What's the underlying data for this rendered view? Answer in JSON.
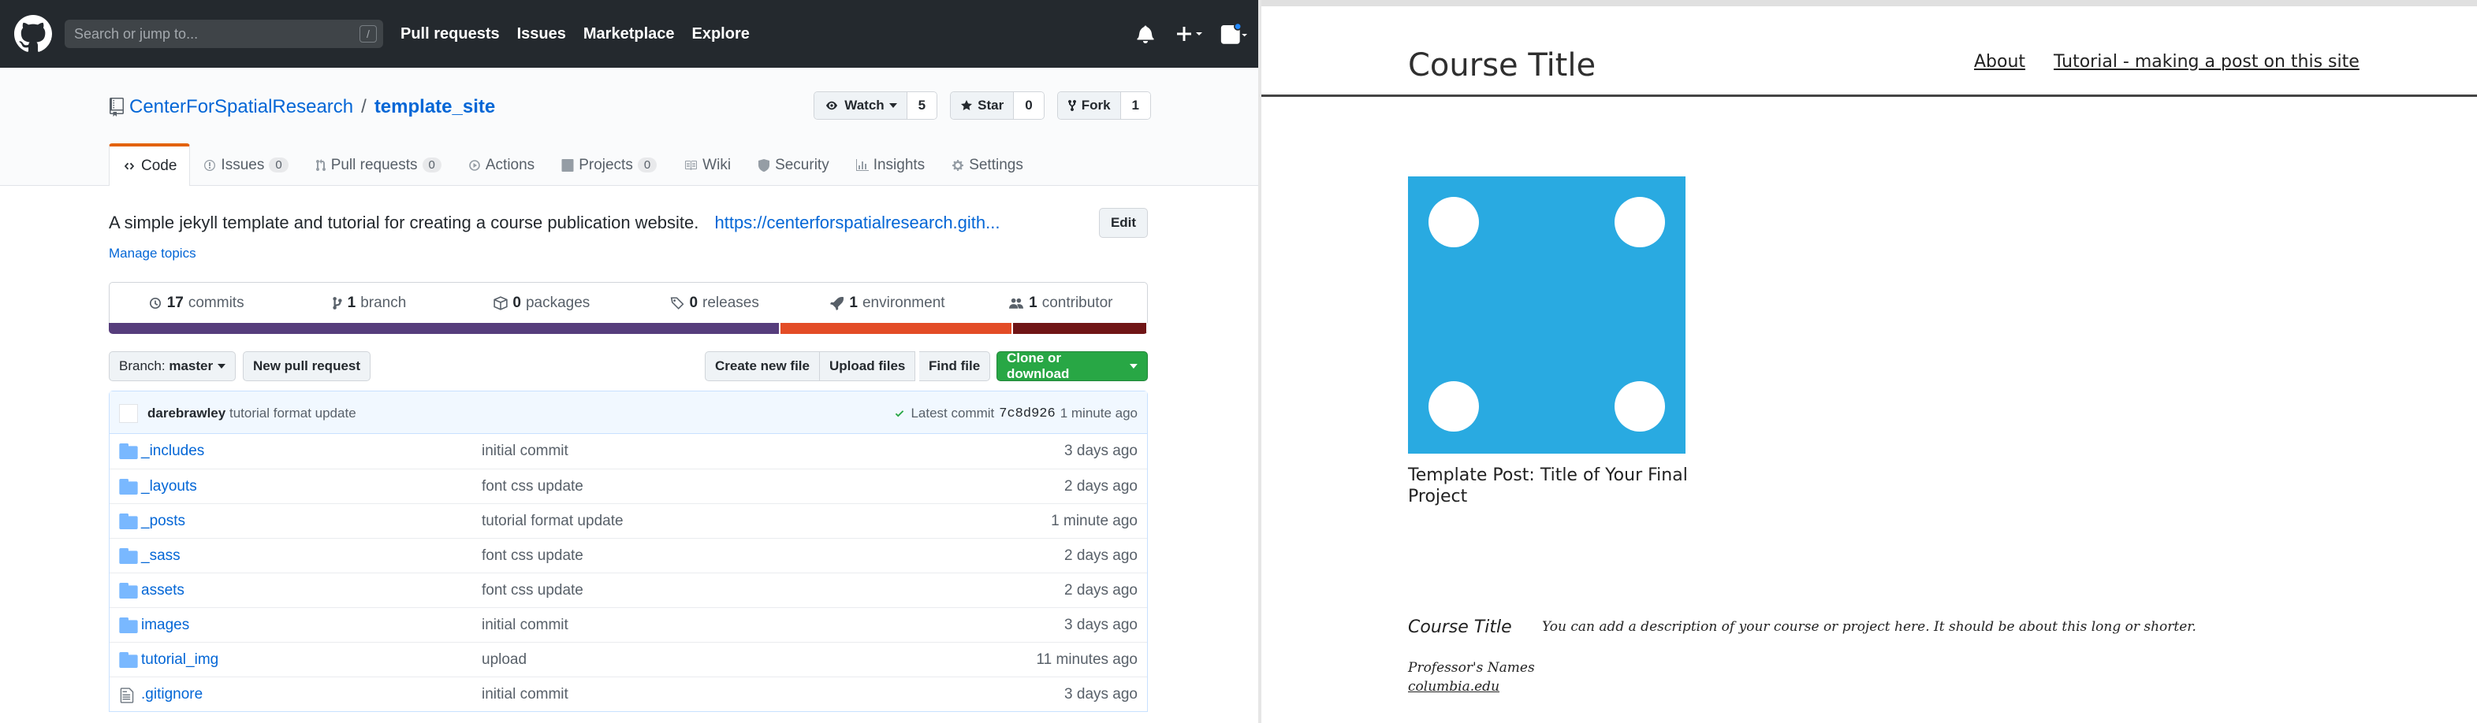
{
  "github": {
    "header": {
      "search_placeholder": "Search or jump to...",
      "search_shortcut": "/",
      "nav": [
        "Pull requests",
        "Issues",
        "Marketplace",
        "Explore"
      ],
      "icons": [
        "bell-icon",
        "plus-icon",
        "avatar"
      ]
    },
    "repo": {
      "owner": "CenterForSpatialResearch",
      "separator": "/",
      "name": "template_site",
      "watch": {
        "label": "Watch",
        "count": "5"
      },
      "star": {
        "label": "Star",
        "count": "0"
      },
      "fork": {
        "label": "Fork",
        "count": "1"
      },
      "tabs": [
        {
          "label": "Code",
          "counter": "",
          "icon": "code-icon"
        },
        {
          "label": "Issues",
          "counter": "0",
          "icon": "issue-icon"
        },
        {
          "label": "Pull requests",
          "counter": "0",
          "icon": "pull-request-icon"
        },
        {
          "label": "Actions",
          "counter": "",
          "icon": "play-icon"
        },
        {
          "label": "Projects",
          "counter": "0",
          "icon": "project-icon"
        },
        {
          "label": "Wiki",
          "counter": "",
          "icon": "book-icon"
        },
        {
          "label": "Security",
          "counter": "",
          "icon": "shield-icon"
        },
        {
          "label": "Insights",
          "counter": "",
          "icon": "graph-icon"
        },
        {
          "label": "Settings",
          "counter": "",
          "icon": "gear-icon"
        }
      ],
      "description": "A simple jekyll template and tutorial for creating a course publication website.",
      "homepage_link": "https://centerforspatialresearch.gith...",
      "edit_label": "Edit",
      "manage_topics": "Manage topics",
      "summary": [
        {
          "count": "17",
          "label": "commits"
        },
        {
          "count": "1",
          "label": "branch"
        },
        {
          "count": "0",
          "label": "packages"
        },
        {
          "count": "0",
          "label": "releases"
        },
        {
          "count": "1",
          "label": "environment"
        },
        {
          "count": "1",
          "label": "contributor"
        }
      ],
      "languages": [
        {
          "color": "#563d7c",
          "share": 0.648
        },
        {
          "color": "#e34c26",
          "share": 0.223
        },
        {
          "color": "#701516",
          "share": 0.129
        }
      ],
      "branch_label": "Branch:",
      "branch_name": "master",
      "new_pr_label": "New pull request",
      "create_file_label": "Create new file",
      "upload_label": "Upload files",
      "find_label": "Find file",
      "clone_label": "Clone or download",
      "latest_commit": {
        "author": "darebrawley",
        "message": "tutorial format update",
        "prefix": "Latest commit",
        "sha": "7c8d926",
        "age": "1 minute ago"
      },
      "files": [
        {
          "type": "folder",
          "name": "_includes",
          "message": "initial commit",
          "age": "3 days ago"
        },
        {
          "type": "folder",
          "name": "_layouts",
          "message": "font css update",
          "age": "2 days ago"
        },
        {
          "type": "folder",
          "name": "_posts",
          "message": "tutorial format update",
          "age": "1 minute ago"
        },
        {
          "type": "folder",
          "name": "_sass",
          "message": "font css update",
          "age": "2 days ago"
        },
        {
          "type": "folder",
          "name": "assets",
          "message": "font css update",
          "age": "2 days ago"
        },
        {
          "type": "folder",
          "name": "images",
          "message": "initial commit",
          "age": "3 days ago"
        },
        {
          "type": "folder",
          "name": "tutorial_img",
          "message": "upload",
          "age": "11 minutes ago"
        },
        {
          "type": "file",
          "name": ".gitignore",
          "message": "initial commit",
          "age": "3 days ago"
        }
      ]
    }
  },
  "site": {
    "title": "Course Title",
    "nav": [
      "About",
      "Tutorial - making a post on this site"
    ],
    "thumbnail_color": "#29aae1",
    "post_title": "Template Post: Title of Your Final Project",
    "footer": {
      "title": "Course Title",
      "description": "You can add a description of your course or project here. It should be about this long or shorter.",
      "professor": "Professor's Names",
      "link": "columbia.edu"
    }
  }
}
